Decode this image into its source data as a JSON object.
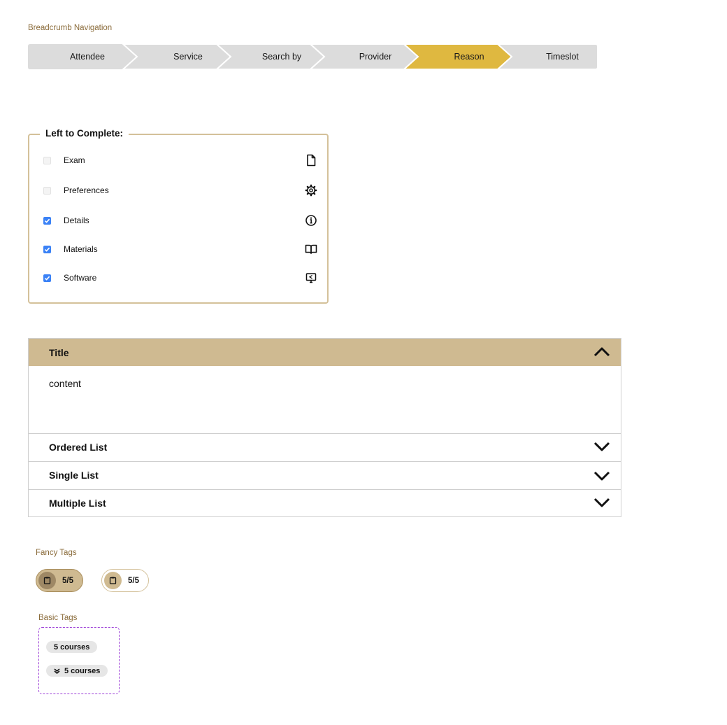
{
  "breadcrumb": {
    "label": "Breadcrumb Navigation",
    "steps": [
      "Attendee",
      "Service",
      "Search by",
      "Provider",
      "Reason",
      "Timeslot"
    ],
    "active_index": 4,
    "colors": {
      "inactive": "#dcdcdc",
      "active": "#dfb840"
    }
  },
  "checklist": {
    "legend": "Left to Complete:",
    "items": [
      {
        "label": "Exam",
        "checked": false,
        "icon": "file-icon"
      },
      {
        "label": "Preferences",
        "checked": false,
        "icon": "gear-icon"
      },
      {
        "label": "Details",
        "checked": true,
        "icon": "info-icon"
      },
      {
        "label": "Materials",
        "checked": true,
        "icon": "book-icon"
      },
      {
        "label": "Software",
        "checked": true,
        "icon": "monitor-share-icon"
      }
    ],
    "border_color": "#d4c19a",
    "checked_color": "#3b82f6"
  },
  "accordion": {
    "panels": [
      {
        "title": "Title",
        "expanded": true,
        "content": "content"
      },
      {
        "title": "Ordered List",
        "expanded": false
      },
      {
        "title": "Single List",
        "expanded": false
      },
      {
        "title": "Multiple List",
        "expanded": false
      }
    ],
    "header_color": "#cfba91"
  },
  "fancy_tags": {
    "label": "Fancy Tags",
    "tags": [
      {
        "text": "5/5",
        "style": "filled",
        "icon": "clipboard-icon"
      },
      {
        "text": "5/5",
        "style": "outlined",
        "icon": "clipboard-icon"
      }
    ]
  },
  "basic_tags": {
    "label": "Basic Tags",
    "tags": [
      {
        "text": "5 courses",
        "icon": null
      },
      {
        "text": "5 courses",
        "icon": "double-check-icon"
      }
    ]
  }
}
